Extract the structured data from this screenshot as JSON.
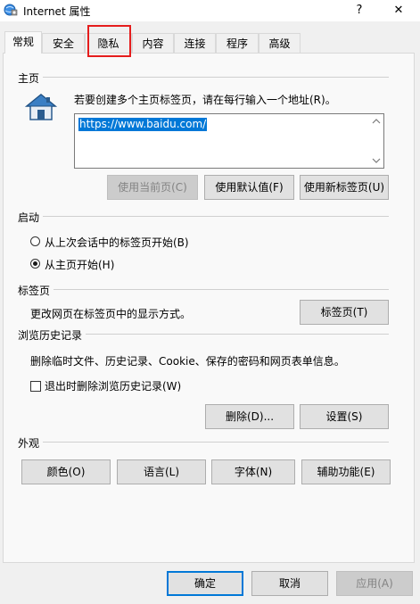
{
  "window": {
    "title": "Internet 属性",
    "help_glyph": "?",
    "close_glyph": "✕"
  },
  "tabs": [
    {
      "label": "常规",
      "active": true
    },
    {
      "label": "安全",
      "active": false
    },
    {
      "label": "隐私",
      "active": false
    },
    {
      "label": "内容",
      "active": false
    },
    {
      "label": "连接",
      "active": false
    },
    {
      "label": "程序",
      "active": false
    },
    {
      "label": "高级",
      "active": false
    }
  ],
  "home": {
    "section_title": "主页",
    "instruction": "若要创建多个主页标签页，请在每行输入一个地址(R)。",
    "url": "https://www.baidu.com/",
    "buttons": {
      "use_current": "使用当前页(C)",
      "use_default": "使用默认值(F)",
      "use_new_tab": "使用新标签页(U)"
    }
  },
  "startup": {
    "section_title": "启动",
    "option_last_session": "从上次会话中的标签页开始(B)",
    "option_home_page": "从主页开始(H)",
    "selected": "home"
  },
  "tabs_section": {
    "section_title": "标签页",
    "description": "更改网页在标签页中的显示方式。",
    "button": "标签页(T)"
  },
  "history": {
    "section_title": "浏览历史记录",
    "description": "删除临时文件、历史记录、Cookie、保存的密码和网页表单信息。",
    "checkbox_label": "退出时删除浏览历史记录(W)",
    "checked": false,
    "delete_button": "删除(D)...",
    "settings_button": "设置(S)"
  },
  "appearance": {
    "section_title": "外观",
    "colors_button": "颜色(O)",
    "languages_button": "语言(L)",
    "fonts_button": "字体(N)",
    "accessibility_button": "辅助功能(E)"
  },
  "footer": {
    "ok": "确定",
    "cancel": "取消",
    "apply": "应用(A)"
  },
  "colors": {
    "accent": "#0078d7",
    "highlight_box": "#e51d1d"
  }
}
